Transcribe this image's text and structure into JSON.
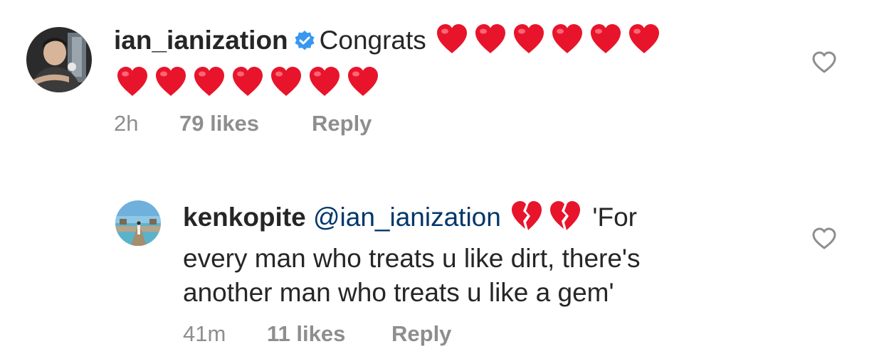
{
  "comments": [
    {
      "username": "ian_ianization",
      "verified": true,
      "text": "Congrats",
      "hearts": 13,
      "emoji": "red-heart",
      "time": "2h",
      "likes": "79 likes",
      "reply": "Reply"
    },
    {
      "username": "kenkopite",
      "mention": "@ian_ianization",
      "emoji": "broken-heart",
      "emoji_count": 2,
      "line1_rest": "'For",
      "line2": "every man who treats u like dirt, there's",
      "line3": "another man who treats u like a gem'",
      "time": "41m",
      "likes": "11 likes",
      "reply": "Reply"
    }
  ],
  "colors": {
    "heart_red": "#e8142b",
    "verified_blue": "#3897f0",
    "mention": "#00376b",
    "meta_grey": "#8e8e8e"
  },
  "icons": [
    "verified-badge-icon",
    "red-heart-emoji",
    "broken-heart-emoji",
    "like-heart-icon"
  ]
}
